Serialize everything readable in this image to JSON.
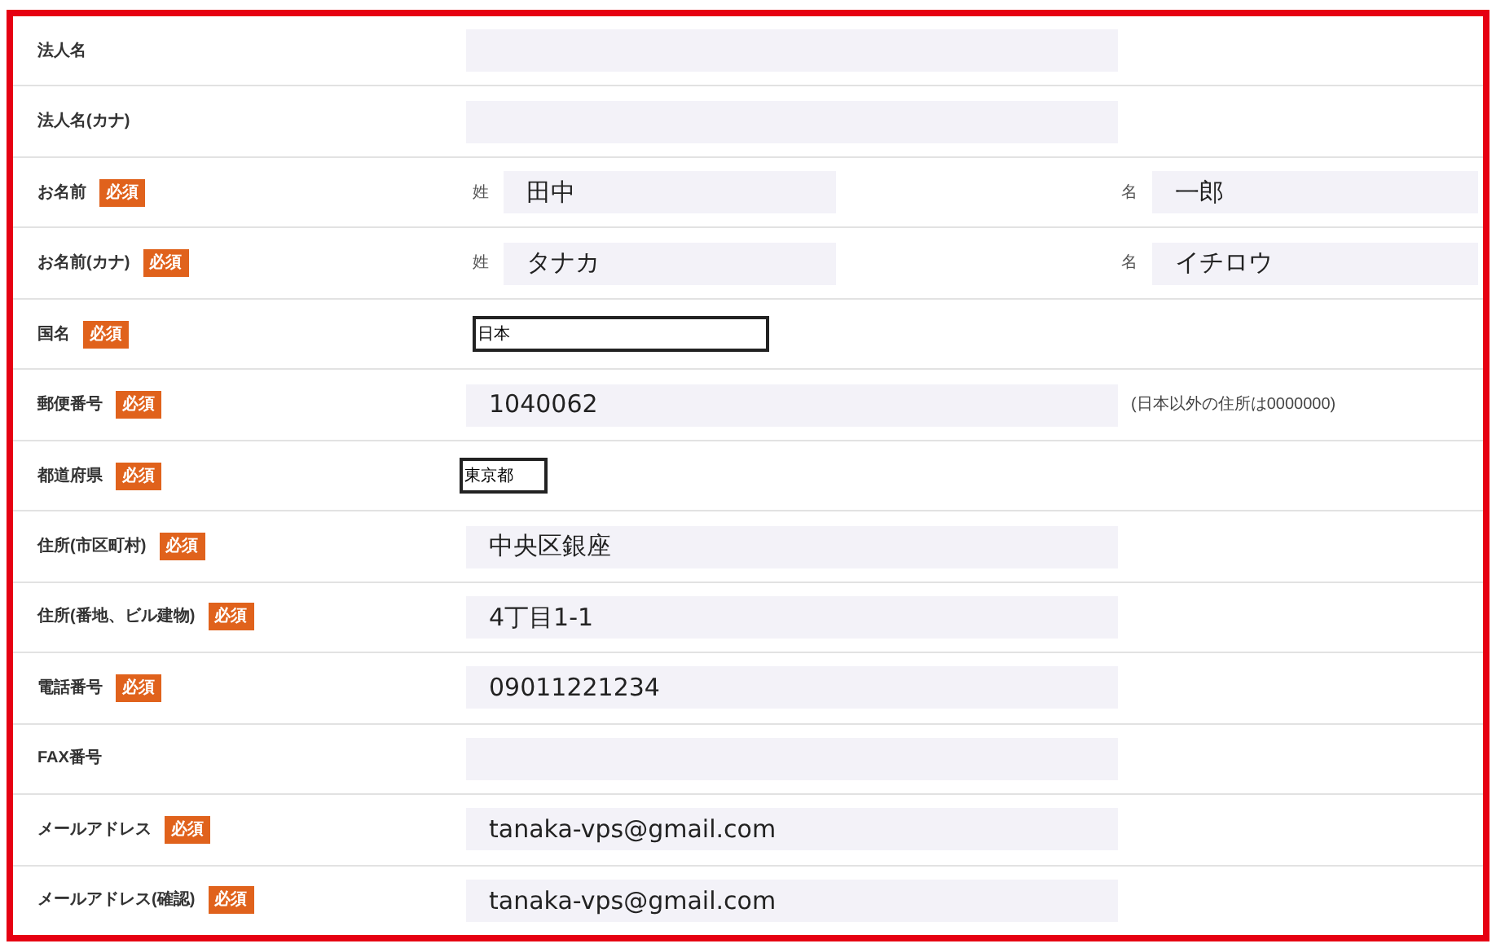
{
  "rows": [
    {
      "kind": "text",
      "label": "法人名"
    },
    {
      "kind": "text",
      "label": "法人名(カナ)"
    },
    {
      "kind": "name",
      "label": "お名前",
      "badge": "必須",
      "first_prefix": "姓",
      "first_value": "田中",
      "second_prefix": "名",
      "second_value": "一郎"
    },
    {
      "kind": "name",
      "label": "お名前(カナ)",
      "badge": "必須",
      "first_prefix": "姓",
      "first_value": "タナカ",
      "second_prefix": "名",
      "second_value": "イチロウ"
    },
    {
      "kind": "wideselect",
      "label": "国名",
      "badge": "必須",
      "value": "日本"
    },
    {
      "kind": "text",
      "label": "郵便番号",
      "badge": "必須",
      "value": "1040062",
      "note": "(日本以外の住所は0000000)"
    },
    {
      "kind": "select",
      "label": "都道府県",
      "badge": "必須",
      "value": "東京都"
    },
    {
      "kind": "text",
      "label": "住所(市区町村)",
      "badge": "必須",
      "value": "中央区銀座"
    },
    {
      "kind": "text",
      "label": "住所(番地、ビル建物)",
      "badge": "必須",
      "value": "4丁目1-1"
    },
    {
      "kind": "text",
      "label": "電話番号",
      "badge": "必須",
      "value": "09011221234"
    },
    {
      "kind": "text",
      "label": "FAX番号"
    },
    {
      "kind": "text",
      "label": "メールアドレス",
      "badge": "必須",
      "value": "tanaka-vps@gmail.com"
    },
    {
      "kind": "text",
      "label": "メールアドレス(確認)",
      "badge": "必須",
      "value": "tanaka-vps@gmail.com"
    }
  ]
}
